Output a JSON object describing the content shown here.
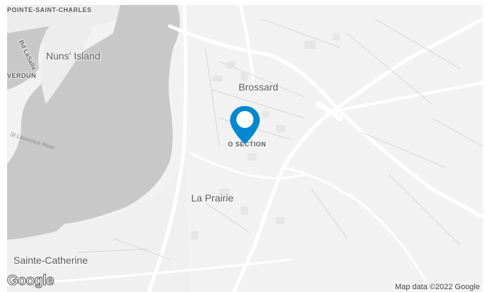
{
  "map": {
    "labels": {
      "pointe_saint_charles": "POINTE-SAINT-CHARLES",
      "bd_lasalle": "Bd LaSalle",
      "nuns_island": "Nuns' Island",
      "verdun": "VERDUN",
      "brossard": "Brossard",
      "st_lawrence_river": "St Lawrence River",
      "o_section": "O SECTION",
      "la_prairie": "La Prairie",
      "sainte_catherine": "Sainte-Catherine"
    },
    "logo": "Google",
    "attribution": "Map data ©2022 Google",
    "marker_color": "#0288d1",
    "water_color": "#c8c8c8",
    "land_color": "#f2f2f2"
  }
}
